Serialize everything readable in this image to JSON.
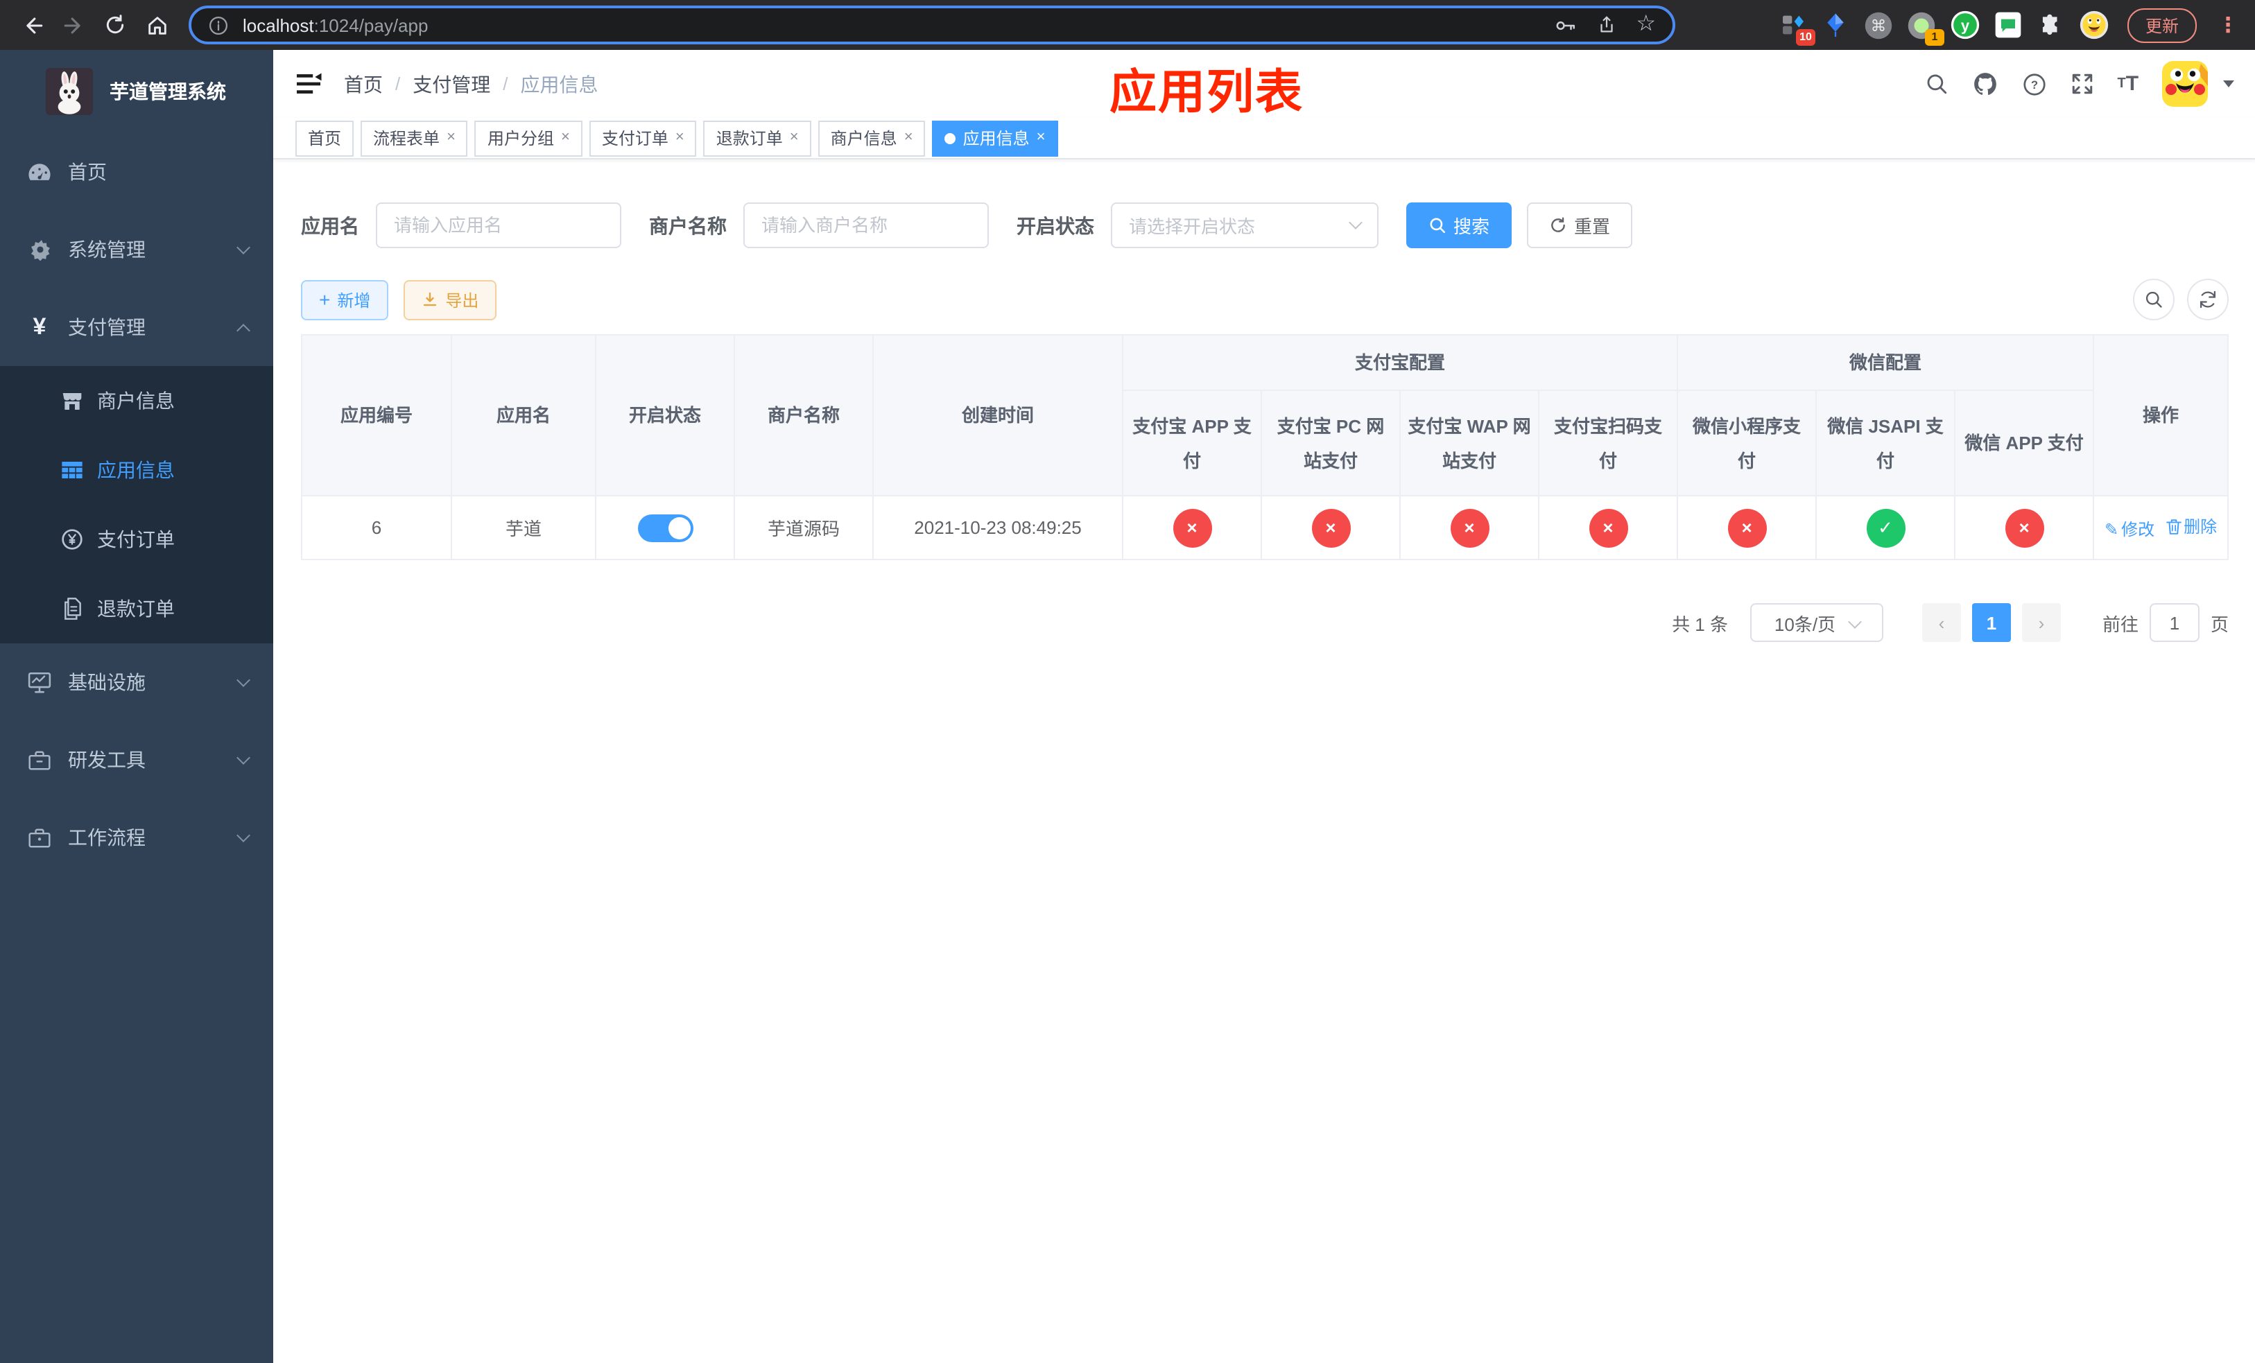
{
  "browser": {
    "url_host": "localhost",
    "url_path": ":1024/pay/app",
    "update_button": "更新",
    "ext_badges": {
      "pinned": "10",
      "monitor": "1"
    }
  },
  "sidebar": {
    "title": "芋道管理系统",
    "items": [
      {
        "label": "首页"
      },
      {
        "label": "系统管理"
      },
      {
        "label": "支付管理"
      },
      {
        "label": "商户信息"
      },
      {
        "label": "应用信息"
      },
      {
        "label": "支付订单"
      },
      {
        "label": "退款订单"
      },
      {
        "label": "基础设施"
      },
      {
        "label": "研发工具"
      },
      {
        "label": "工作流程"
      }
    ]
  },
  "navbar": {
    "breadcrumb": [
      "首页",
      "支付管理",
      "应用信息"
    ],
    "separator": "/",
    "overlay_title": "应用列表"
  },
  "tabs": [
    {
      "label": "首页"
    },
    {
      "label": "流程表单"
    },
    {
      "label": "用户分组"
    },
    {
      "label": "支付订单"
    },
    {
      "label": "退款订单"
    },
    {
      "label": "商户信息"
    },
    {
      "label": "应用信息"
    }
  ],
  "search": {
    "app_name_label": "应用名",
    "app_name_placeholder": "请输入应用名",
    "merchant_label": "商户名称",
    "merchant_placeholder": "请输入商户名称",
    "status_label": "开启状态",
    "status_placeholder": "请选择开启状态",
    "search_button": "搜索",
    "reset_button": "重置"
  },
  "toolbar": {
    "add_button": "新增",
    "export_button": "导出"
  },
  "table": {
    "headers": {
      "app_id": "应用编号",
      "app_name": "应用名",
      "status": "开启状态",
      "merchant": "商户名称",
      "created": "创建时间",
      "alipay_group": "支付宝配置",
      "wechat_group": "微信配置",
      "alipay_app": "支付宝 APP 支付",
      "alipay_pc": "支付宝 PC 网站支付",
      "alipay_wap": "支付宝 WAP 网站支付",
      "alipay_qr": "支付宝扫码支付",
      "wx_mini": "微信小程序支付",
      "wx_jsapi": "微信 JSAPI 支付",
      "wx_app": "微信 APP 支付",
      "actions": "操作"
    },
    "row": {
      "app_id": "6",
      "app_name": "芋道",
      "status_on": true,
      "merchant": "芋道源码",
      "created": "2021-10-23 08:49:25",
      "pay_status": [
        false,
        false,
        false,
        false,
        false,
        true,
        false
      ],
      "edit_label": "修改",
      "delete_label": "删除"
    }
  },
  "pagination": {
    "total": "共 1 条",
    "page_size": "10条/页",
    "page": "1",
    "goto_label": "前往",
    "goto_value": "1",
    "page_unit": "页"
  },
  "icons": {
    "close": "×",
    "check": "✓",
    "cross": "×",
    "plus": "+",
    "dots_vertical": "⋮",
    "star": "☆",
    "yen": "¥",
    "pencil": "✎",
    "prev": "‹",
    "next": "›"
  },
  "colors": {
    "accent": "#409eff",
    "overlay_title": "#ff2600",
    "status_on": "#1ec76a",
    "status_off": "#f54a4a",
    "sidebar_bg": "#304156",
    "submenu_bg": "#1f2d3d",
    "warning": "#e6a23c",
    "tab_active": "#409eff"
  }
}
